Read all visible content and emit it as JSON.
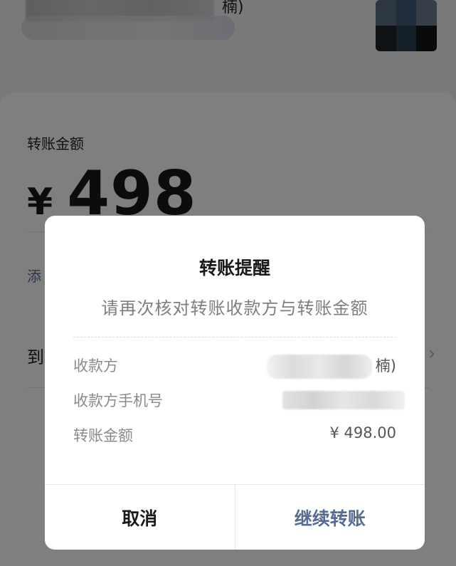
{
  "background": {
    "payee_name_suffix": "楠)",
    "amount_label": "转账金额",
    "currency_symbol": "¥",
    "amount_value": "498",
    "add_note_label": "添",
    "arrival_label": "到",
    "chevron_glyph": "›"
  },
  "dialog": {
    "title": "转账提醒",
    "subtitle": "请再次核对转账收款方与转账金额",
    "rows": [
      {
        "label": "收款方",
        "value": "楠)"
      },
      {
        "label": "收款方手机号",
        "value": ""
      },
      {
        "label": "转账金额",
        "value": "¥ 498.00"
      }
    ],
    "buttons": {
      "cancel": "取消",
      "continue": "继续转账"
    }
  },
  "colors": {
    "accent": "#576b95",
    "overlay": "rgba(0,0,0,0.5)"
  }
}
